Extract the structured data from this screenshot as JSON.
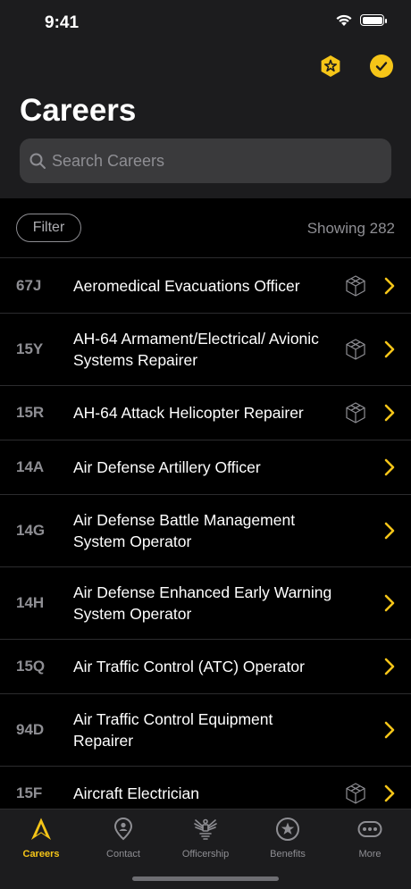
{
  "status": {
    "time": "9:41"
  },
  "header": {
    "title": "Careers"
  },
  "search": {
    "placeholder": "Search Careers"
  },
  "filter": {
    "label": "Filter",
    "showing": "Showing 282"
  },
  "careers": [
    {
      "code": "67J",
      "name": "Aeromedical Evacuations Officer",
      "has_badge": true
    },
    {
      "code": "15Y",
      "name": "AH-64 Armament/Electrical/ Avionic Systems Repairer",
      "has_badge": true
    },
    {
      "code": "15R",
      "name": "AH-64 Attack Helicopter Repairer",
      "has_badge": true
    },
    {
      "code": "14A",
      "name": "Air Defense Artillery Officer",
      "has_badge": false
    },
    {
      "code": "14G",
      "name": "Air Defense Battle Management System Operator",
      "has_badge": false
    },
    {
      "code": "14H",
      "name": "Air Defense Enhanced Early Warning System Operator",
      "has_badge": false
    },
    {
      "code": "15Q",
      "name": "Air Traffic Control (ATC) Operator",
      "has_badge": false
    },
    {
      "code": "94D",
      "name": "Air Traffic Control Equipment Repairer",
      "has_badge": false
    },
    {
      "code": "15F",
      "name": "Aircraft Electrician",
      "has_badge": true
    }
  ],
  "tabs": [
    {
      "label": "Careers",
      "icon": "careers-icon",
      "active": true
    },
    {
      "label": "Contact",
      "icon": "contact-pin-icon",
      "active": false
    },
    {
      "label": "Officership",
      "icon": "officership-eagle-icon",
      "active": false
    },
    {
      "label": "Benefits",
      "icon": "benefits-star-icon",
      "active": false
    },
    {
      "label": "More",
      "icon": "more-dots-icon",
      "active": false
    }
  ],
  "colors": {
    "accent": "#f5c518",
    "background": "#000000",
    "header_bg": "#1c1c1e",
    "muted": "#8e8e93"
  }
}
